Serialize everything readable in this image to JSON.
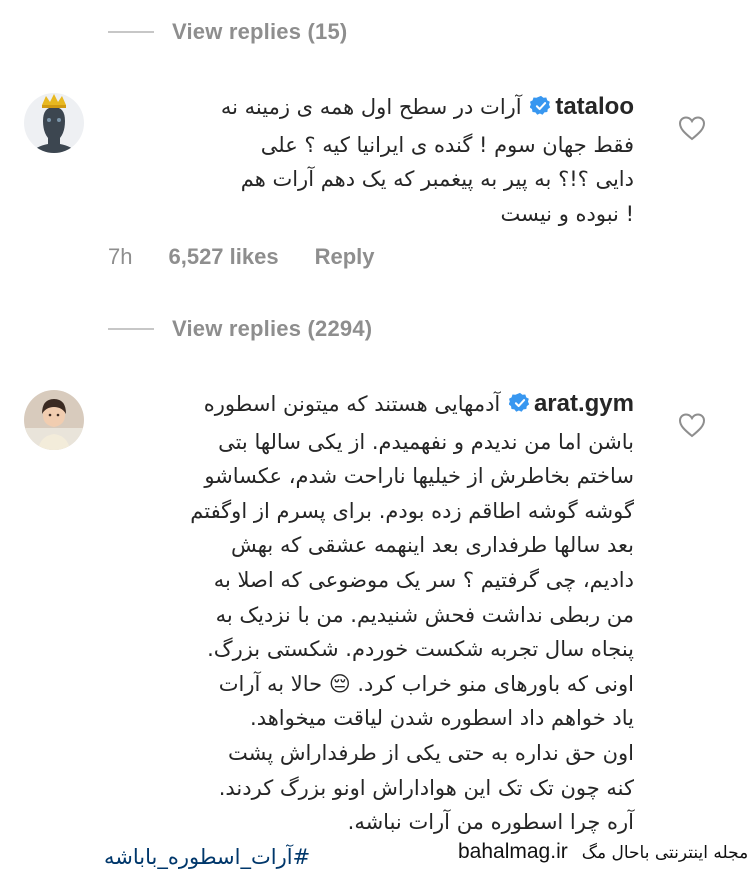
{
  "view_replies_1": {
    "label": "View replies (15)"
  },
  "comment_1": {
    "username": "tataloo",
    "verified": true,
    "avatar": "crowned-man-avatar",
    "lines": [
      "آرات در سطح اول همه ی زمینه نه",
      "فقط جهان سوم ! گنده ی ایرانیا کیه ؟ علی",
      "دایی ؟!؟ به پیر به پیغمبر که یک دهم آرات هم",
      "! نبوده و نیست"
    ],
    "time": "7h",
    "likes": "6,527 likes",
    "reply_label": "Reply"
  },
  "view_replies_2": {
    "label": "View replies (2294)"
  },
  "comment_2": {
    "username": "arat.gym",
    "verified": true,
    "avatar": "boy-avatar",
    "lines": [
      "آدمهایی هستند که میتونن اسطوره",
      "باشن اما من ندیدم و نفهمیدم. از یکی سالها بتی",
      "ساختم بخاطرش از خیلیها ناراحت شدم، عکساشو",
      "گوشه گوشه اطاقم زده بودم. برای پسرم از اوگفتم",
      "بعد سالها طرفداری بعد اینهمه عشقی که بهش",
      "دادیم، چی گرفتیم ؟ سر یک موضوعی که اصلا به",
      "من ربطی نداشت فحش شنیدیم. من با نزدیک به",
      "پنجاه سال تجربه شکست خوردم. شکستی بزرگ.",
      "اونی که باورهای منو خراب کرد. 😔 حالا به آرات",
      "یاد خواهم داد اسطوره شدن لیاقت میخواهد.",
      "اون حق نداره به حتی یکی از طرفداراش پشت",
      "کنه چون تک تک این هواداراش اونو بزرگ کردند.",
      "آره چرا اسطوره من آرات نباشه."
    ],
    "hashtag": "#آرات_اسطوره_باباشه"
  },
  "icons": {
    "verified": "verified-badge-icon",
    "like": "heart-icon"
  },
  "colors": {
    "text": "#262626",
    "muted": "#8e8e8e",
    "verified": "#3897f0",
    "hashtag": "#00376b",
    "divider": "#c7c7c7"
  },
  "watermark": {
    "domain": "bahalmag.ir",
    "text": "مجله اینترنتی باحال مگ"
  }
}
